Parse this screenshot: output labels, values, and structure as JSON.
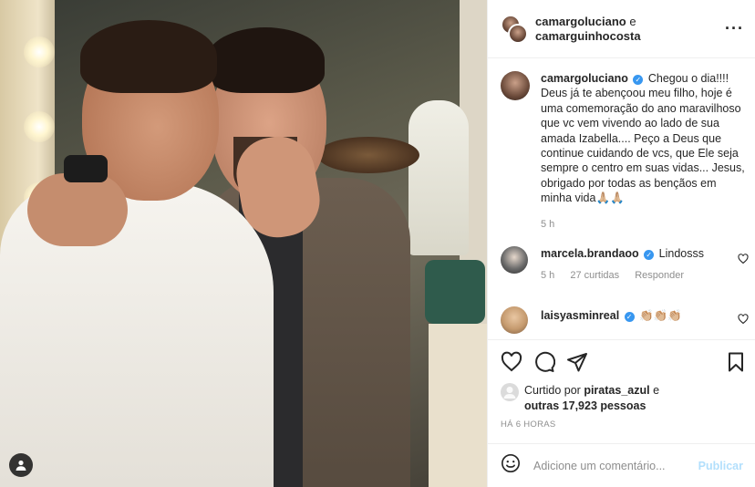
{
  "post": {
    "image_alt": "",
    "tag_icon": "user-tag-icon"
  },
  "header": {
    "user1": "camargoluciano",
    "conj": "e",
    "user2": "camarguinhocosta",
    "more_icon": "more-options-icon"
  },
  "caption": {
    "username": "camargoluciano",
    "text": "Chegou o dia!!!! Deus já te abençoou meu filho, hoje é uma comemoração do ano maravilhoso que vc vem vivendo ao lado de sua amada Izabella.... Peço a Deus que continue cuidando de vcs, que Ele seja sempre o centro em suas vidas... Jesus, obrigado por todas as bençãos em minha vida🙏🏼🙏🏼",
    "time": "5 h"
  },
  "comments": [
    {
      "username": "marcela.brandaoo",
      "text": "Lindosss",
      "time": "5 h",
      "likes": "27 curtidas",
      "reply": "Responder"
    },
    {
      "username": "laisyasminreal",
      "text": "👏🏼👏🏼👏🏼"
    }
  ],
  "likes": {
    "prefix": "Curtido por",
    "user": "piratas_azul",
    "conj": "e",
    "others": "outras 17,923 pessoas"
  },
  "timestamp": "HÁ 6 HORAS",
  "add_comment": {
    "placeholder": "Adicione um comentário...",
    "publish": "Publicar"
  },
  "colors": {
    "verified": "#3897f0",
    "muted": "#8e8e8e",
    "publish_disabled": "#b2dffc"
  }
}
